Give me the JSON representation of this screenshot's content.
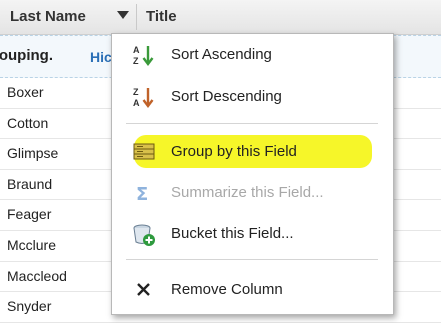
{
  "header": {
    "last_name": "Last Name",
    "title": "Title"
  },
  "banner": {
    "text": "rouping.",
    "link": "Hic"
  },
  "rows": [
    "Boxer",
    "Cotton",
    "Glimpse",
    "Braund",
    "Feager",
    "Mcclure",
    "Maccleod",
    "Snyder"
  ],
  "menu": {
    "sort_ascending": "Sort Ascending",
    "sort_descending": "Sort Descending",
    "group_by": "Group by this Field",
    "summarize": "Summarize this Field...",
    "bucket": "Bucket this Field...",
    "remove": "Remove Column"
  },
  "colors": {
    "highlight": "#f5f51e",
    "link": "#2a6fb6",
    "sort_asc_arrow": "#3a9a3a",
    "sort_desc_arrow": "#c0622a",
    "disabled": "#a8a8a8"
  }
}
